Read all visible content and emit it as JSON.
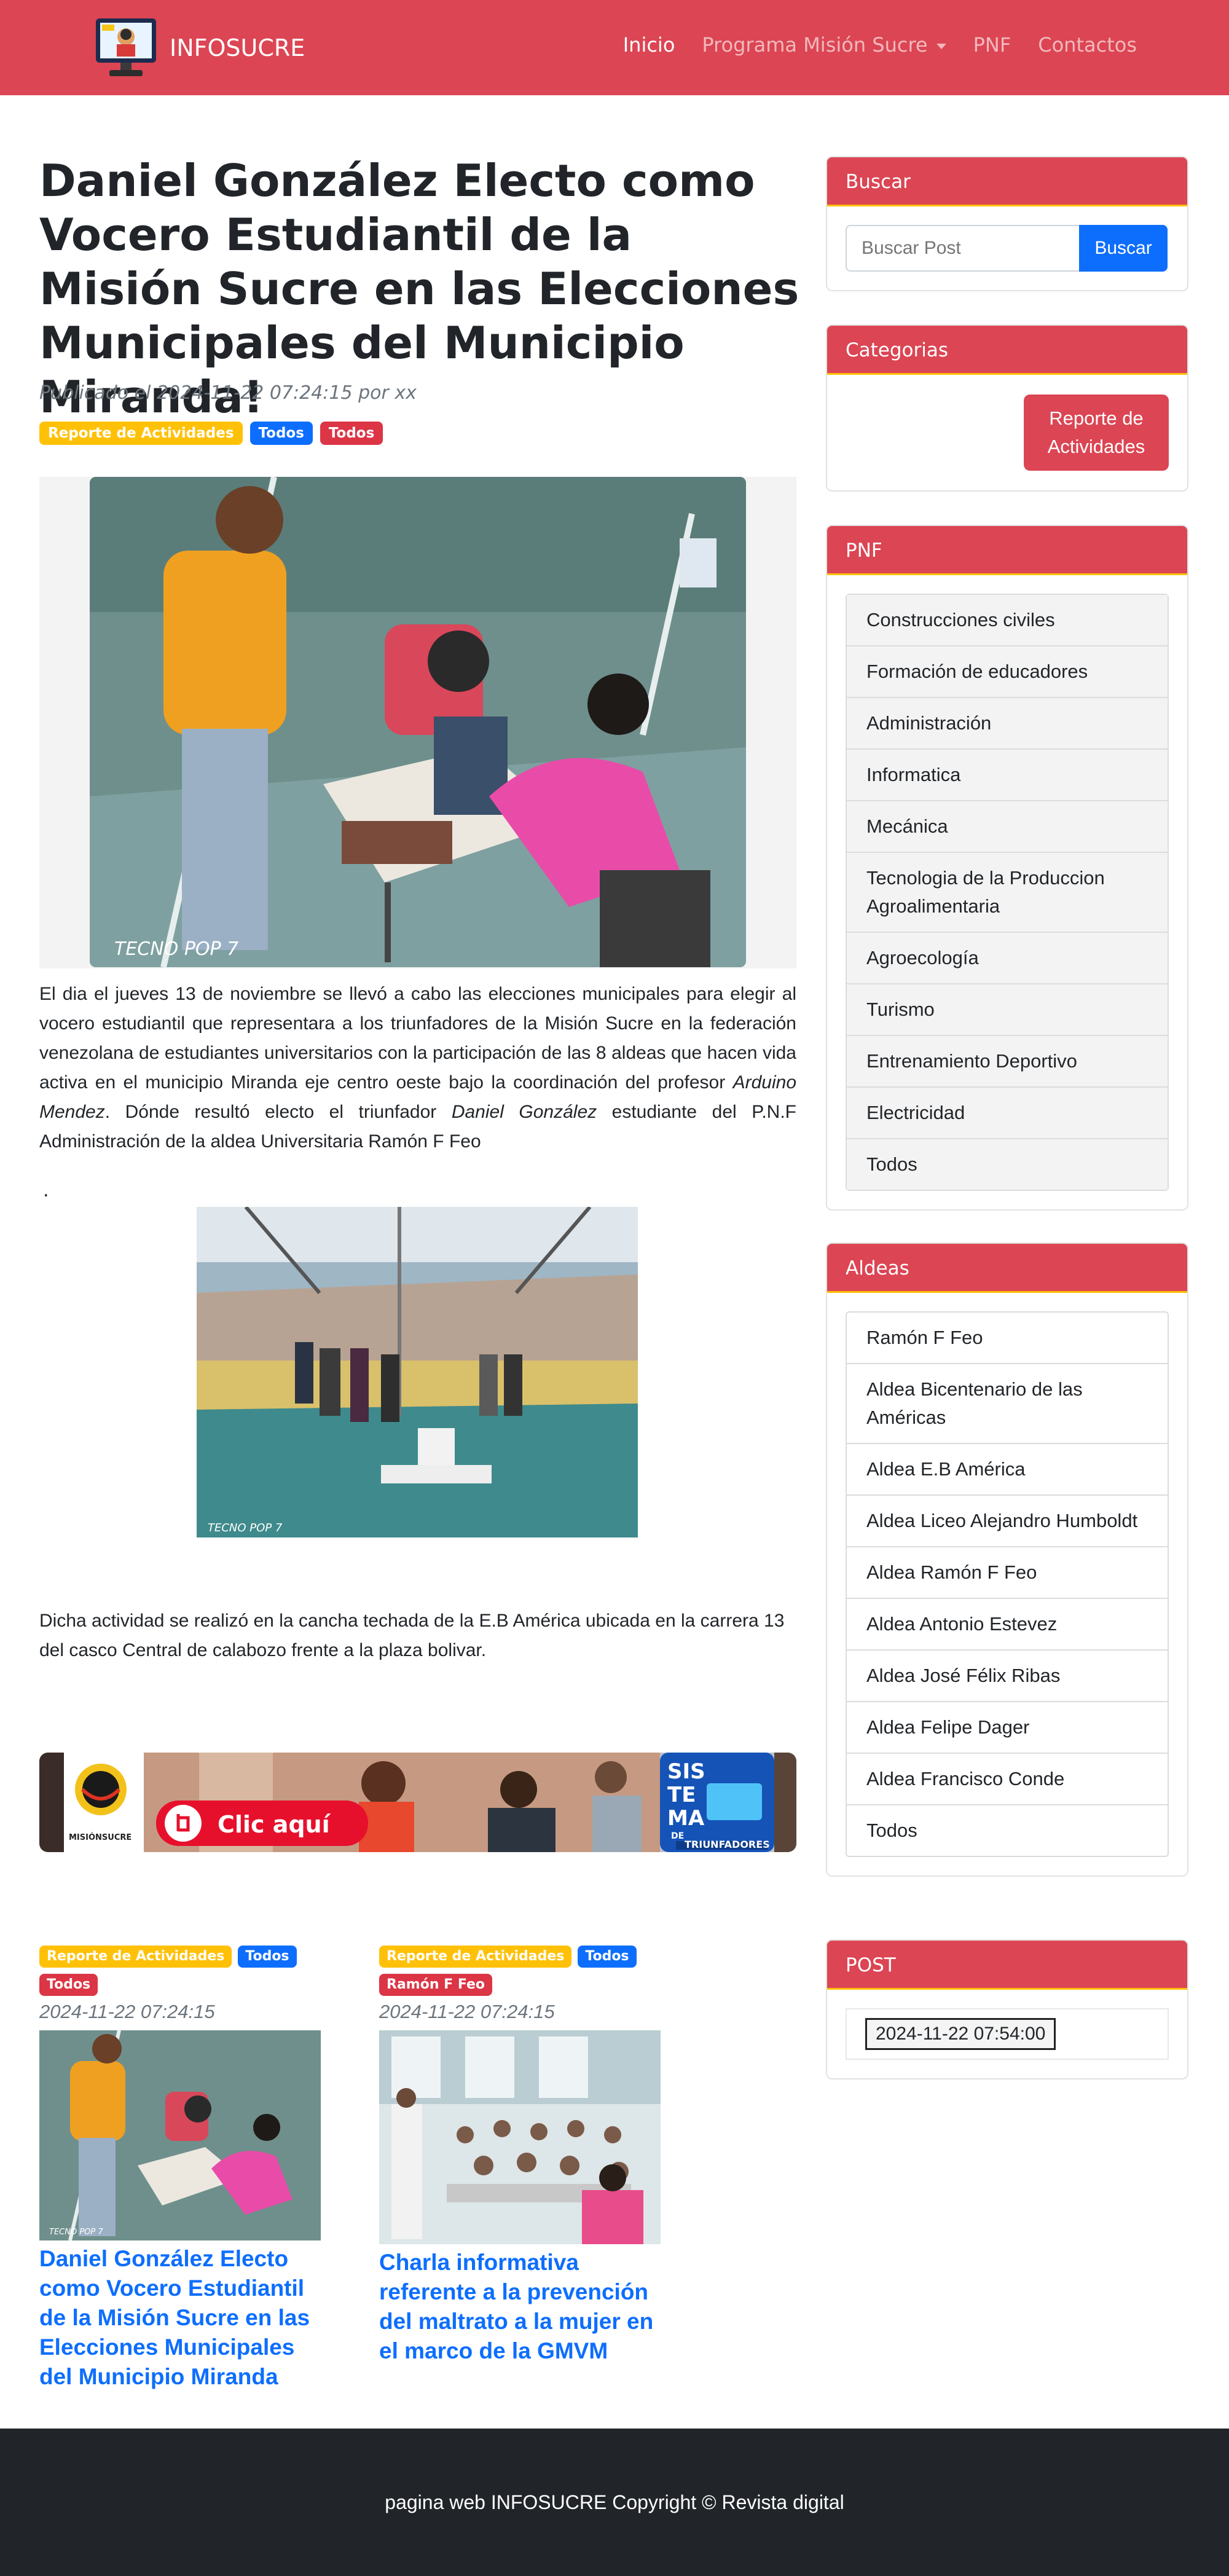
{
  "navbar": {
    "brand": "INFOSUCRE",
    "links": [
      "Inicio",
      "Programa Misión Sucre",
      "PNF",
      "Contactos"
    ]
  },
  "post": {
    "title": "Daniel González Electo como Vocero Estudiantil de la Misión Sucre en las Elecciones Municipales del Municipio Miranda!",
    "meta": "Publicado el 2024-11-22 07:24:15 por xx",
    "tags": [
      "Reporte de Actividades",
      "Todos",
      "Todos"
    ],
    "hero_watermark": "TECNO POP 7",
    "para1_a": "El dia el jueves 13 de noviembre se llevó a cabo las elecciones municipales para elegir al vocero estudiantil que representara a los triunfadores de la Misión Sucre en la federación venezolana de estudiantes universitarios con la participación de las 8 aldeas que hacen vida activa en el municipio Miranda eje centro oeste  bajo la coordinación del profesor ",
    "para1_name1": "Arduino Mendez",
    "para1_b": ". Dónde resultó electo el triunfador ",
    "para1_name2": "Daniel González",
    "para1_c": " estudiante del P.N.F Administración de la aldea Universitaria Ramón F Feo",
    "dot": ".",
    "photo2_watermark": "TECNO POP 7",
    "para2": "Dicha actividad se realizó en la cancha techada de la E.B América ubicada en la carrera 13 del casco Central de calabozo frente a la plaza bolivar."
  },
  "banner": {
    "logo_text": "MISIÓNSUCRE",
    "cta": "Clic aquí",
    "sistema_lines": [
      "SIS",
      "TE",
      "MA"
    ],
    "de": "DE",
    "triunfadores": "TRIUNFADORES"
  },
  "related": [
    {
      "tags": [
        "Reporte de Actividades",
        "Todos",
        "Todos"
      ],
      "date": "2024-11-22 07:24:15",
      "watermark": "TECNO POP 7",
      "title": "Daniel González Electo como Vocero Estudiantil de la Misión Sucre en las Elecciones Municipales del Municipio Miranda"
    },
    {
      "tags": [
        "Reporte de Actividades",
        "Todos",
        "Ramón F Feo"
      ],
      "date": "2024-11-22 07:24:15",
      "title": "Charla informativa referente a la prevención del maltrato a la mujer en el marco de la GMVM"
    }
  ],
  "sidebar": {
    "search": {
      "title": "Buscar",
      "placeholder": "Buscar Post",
      "button": "Buscar"
    },
    "categories": {
      "title": "Categorias",
      "button": "Reporte de Actividades"
    },
    "pnf": {
      "title": "PNF",
      "items": [
        "Construcciones civiles",
        "Formación de educadores",
        "Administración",
        "Informatica",
        "Mecánica",
        "Tecnologia de la Produccion Agroalimentaria",
        "Agroecología",
        "Turismo",
        "Entrenamiento Deportivo",
        "Electricidad",
        "Todos"
      ]
    },
    "aldeas": {
      "title": "Aldeas",
      "items": [
        "Ramón F Feo",
        "Aldea Bicentenario de las Américas",
        "Aldea E.B América",
        "Aldea Liceo Alejandro Humboldt",
        "Aldea Ramón F Feo",
        "Aldea Antonio Estevez",
        "Aldea José Félix Ribas",
        "Aldea Felipe Dager",
        "Aldea Francisco Conde",
        "Todos"
      ]
    },
    "post": {
      "title": "POST",
      "button": "2024-11-22 07:54:00"
    }
  },
  "footer": {
    "text": "pagina web INFOSUCRE Copyright © Revista digital"
  },
  "colors": {
    "primary": "#dc4553",
    "blue": "#0d6efd",
    "warning": "#ffc107",
    "dark": "#212529"
  }
}
